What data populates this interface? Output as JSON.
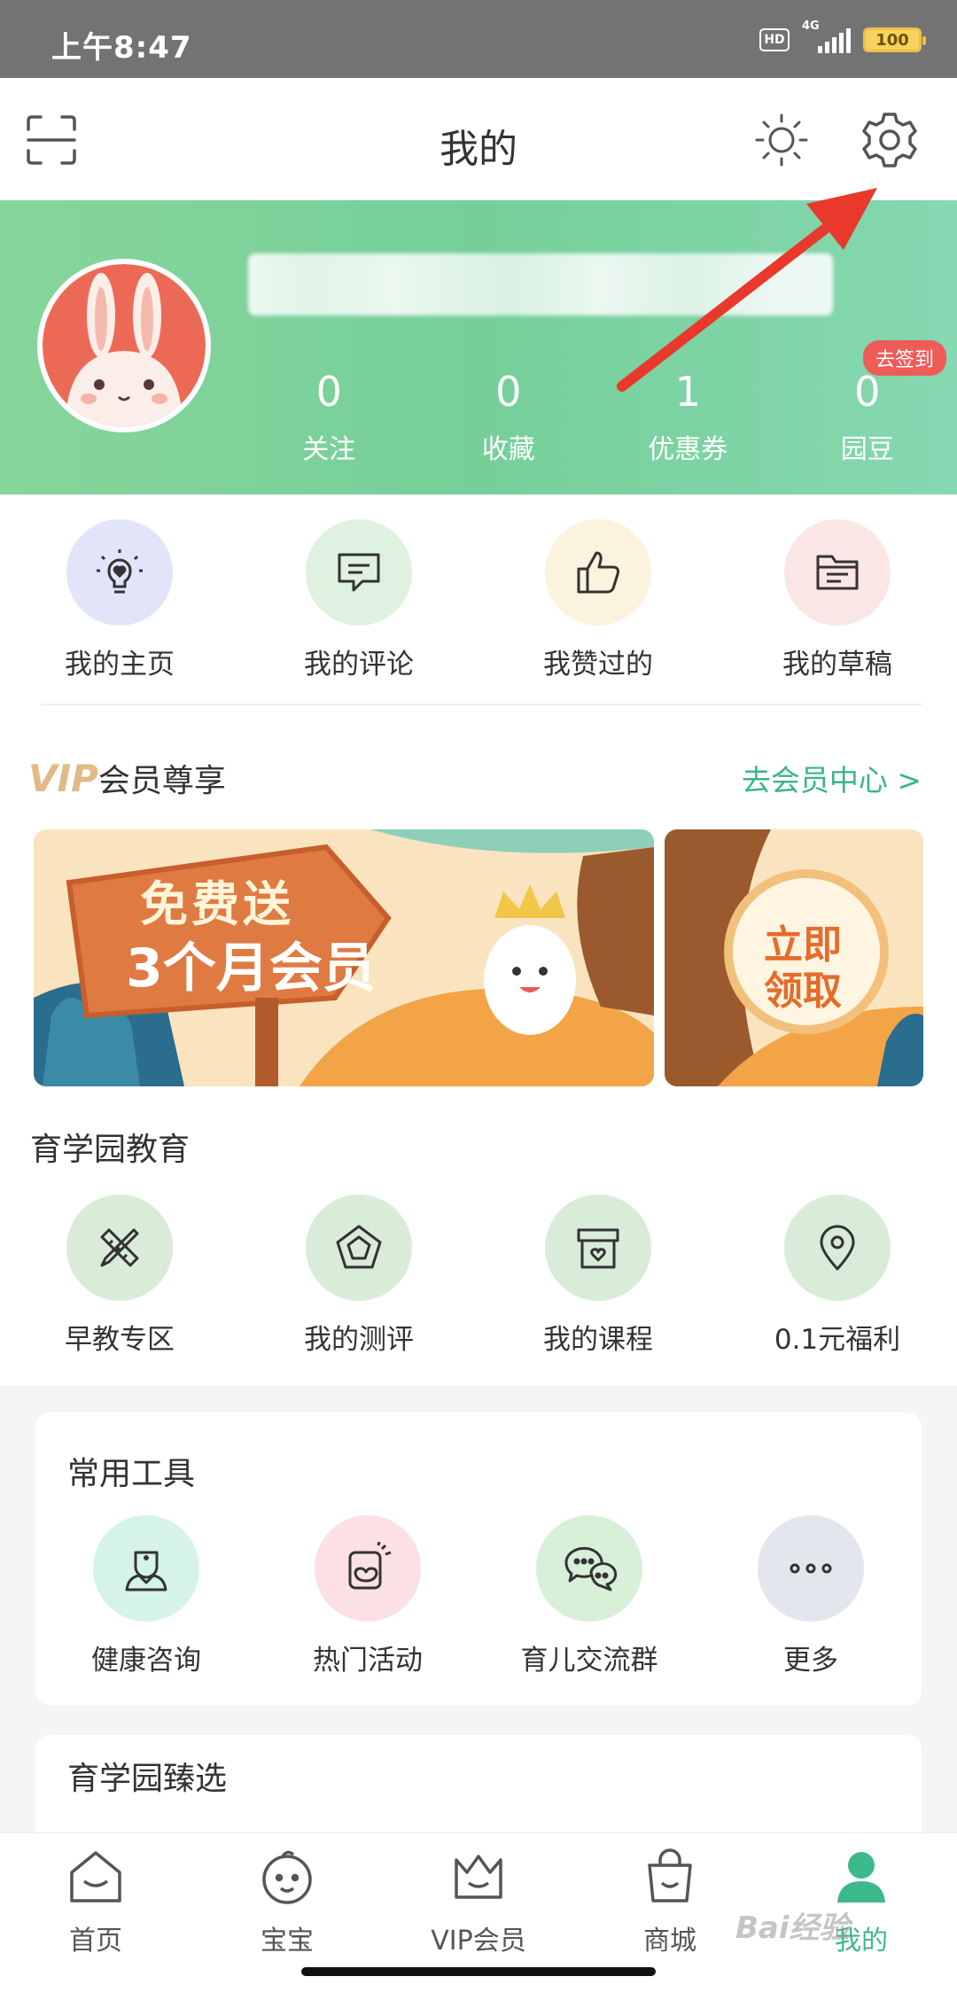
{
  "status_bar": {
    "time": "上午8:47",
    "hd": "HD",
    "network": "4G",
    "battery": "100"
  },
  "header": {
    "title": "我的"
  },
  "profile": {
    "signin_badge": "去签到",
    "stats": [
      {
        "value": "0",
        "label": "关注"
      },
      {
        "value": "0",
        "label": "收藏"
      },
      {
        "value": "1",
        "label": "优惠券"
      },
      {
        "value": "0",
        "label": "园豆"
      }
    ]
  },
  "quick_actions": [
    {
      "label": "我的主页",
      "icon": "bulb-heart-icon",
      "bg": "#e2e4fa"
    },
    {
      "label": "我的评论",
      "icon": "comment-icon",
      "bg": "#dff1df"
    },
    {
      "label": "我赞过的",
      "icon": "thumbs-up-icon",
      "bg": "#fbf3dd"
    },
    {
      "label": "我的草稿",
      "icon": "folder-icon",
      "bg": "#fbe6e6"
    }
  ],
  "vip": {
    "title_vip": "VIP",
    "title_rest": "会员尊享",
    "link": "去会员中心 >",
    "banner_main_line1": "免费送",
    "banner_main_line2": "3个月会员",
    "banner_side_line1": "立即",
    "banner_side_line2": "领取"
  },
  "education": {
    "title": "育学园教育",
    "items": [
      {
        "label": "早教专区",
        "icon": "ruler-pencil-icon"
      },
      {
        "label": "我的测评",
        "icon": "pentagon-icon"
      },
      {
        "label": "我的课程",
        "icon": "box-heart-icon"
      },
      {
        "label": "0.1元福利",
        "icon": "location-pin-icon"
      }
    ]
  },
  "tools": {
    "title": "常用工具",
    "items": [
      {
        "label": "健康咨询",
        "icon": "doctor-icon",
        "bg": "#d6f3ea"
      },
      {
        "label": "热门活动",
        "icon": "activity-icon",
        "bg": "#fbe0e4"
      },
      {
        "label": "育儿交流群",
        "icon": "chat-group-icon",
        "bg": "#d8efd8"
      },
      {
        "label": "更多",
        "icon": "more-icon",
        "bg": "#e3e6ed"
      }
    ]
  },
  "selection": {
    "title": "育学园臻选"
  },
  "bottom_nav": [
    {
      "label": "首页",
      "icon": "home-icon",
      "active": false
    },
    {
      "label": "宝宝",
      "icon": "baby-icon",
      "active": false
    },
    {
      "label": "VIP会员",
      "icon": "vip-crown-icon",
      "active": false
    },
    {
      "label": "商城",
      "icon": "shopping-bag-icon",
      "active": false
    },
    {
      "label": "我的",
      "icon": "user-icon",
      "active": true
    }
  ],
  "watermark": "Bai经验",
  "colors": {
    "accent": "#3cb98a",
    "profile_bg": "#7fd39b",
    "icon_green": "#d8ecd8"
  }
}
